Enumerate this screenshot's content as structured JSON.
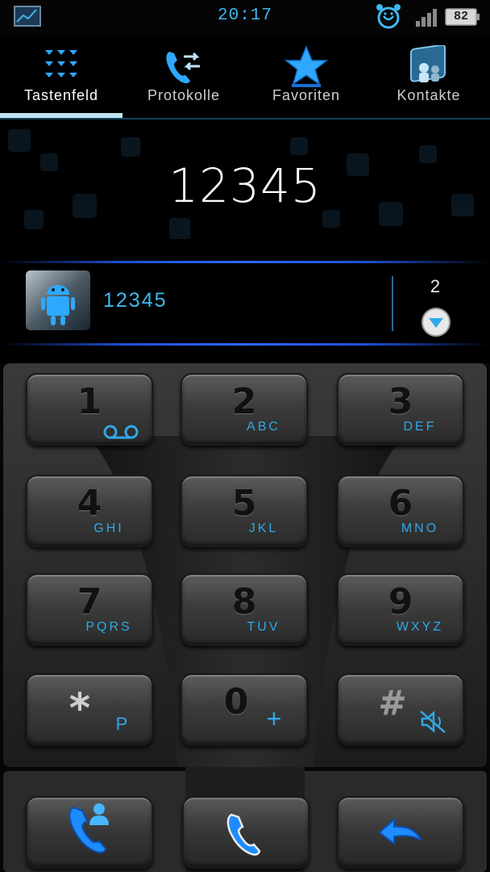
{
  "status_bar": {
    "time": "20:17",
    "battery_level": "82",
    "icons": [
      "gallery-icon",
      "alarm-clock-icon",
      "signal-icon",
      "battery-icon"
    ]
  },
  "tabs": [
    {
      "label": "Tastenfeld",
      "icon": "dialpad-icon",
      "active": true
    },
    {
      "label": "Protokolle",
      "icon": "call-log-icon",
      "active": false
    },
    {
      "label": "Favoriten",
      "icon": "star-icon",
      "active": false
    },
    {
      "label": "Kontakte",
      "icon": "contacts-icon",
      "active": false
    }
  ],
  "dialer": {
    "entered_number": "12345"
  },
  "suggestion": {
    "number": "12345",
    "match_count": "2",
    "avatar_icon": "android-robot-icon",
    "expand_icon": "chevron-down-icon"
  },
  "keys": [
    {
      "digit": "1",
      "letters": "",
      "icon": "voicemail-icon"
    },
    {
      "digit": "2",
      "letters": "ABC"
    },
    {
      "digit": "3",
      "letters": "DEF"
    },
    {
      "digit": "4",
      "letters": "GHI"
    },
    {
      "digit": "5",
      "letters": "JKL"
    },
    {
      "digit": "6",
      "letters": "MNO"
    },
    {
      "digit": "7",
      "letters": "PQRS"
    },
    {
      "digit": "8",
      "letters": "TUV"
    },
    {
      "digit": "9",
      "letters": "WXYZ"
    },
    {
      "digit": "*",
      "letters": "P"
    },
    {
      "digit": "0",
      "letters": "+"
    },
    {
      "digit": "#",
      "letters": "",
      "icon": "mute-icon"
    }
  ],
  "actions": [
    {
      "name": "add-contact",
      "icon": "add-contact-phone-icon"
    },
    {
      "name": "call",
      "icon": "phone-icon"
    },
    {
      "name": "backspace",
      "icon": "back-arrow-icon"
    }
  ],
  "colors": {
    "accent": "#3fb8ee",
    "indicator": "#bfe4f3",
    "glow": "#2e68ff",
    "key_text": "#111111"
  }
}
